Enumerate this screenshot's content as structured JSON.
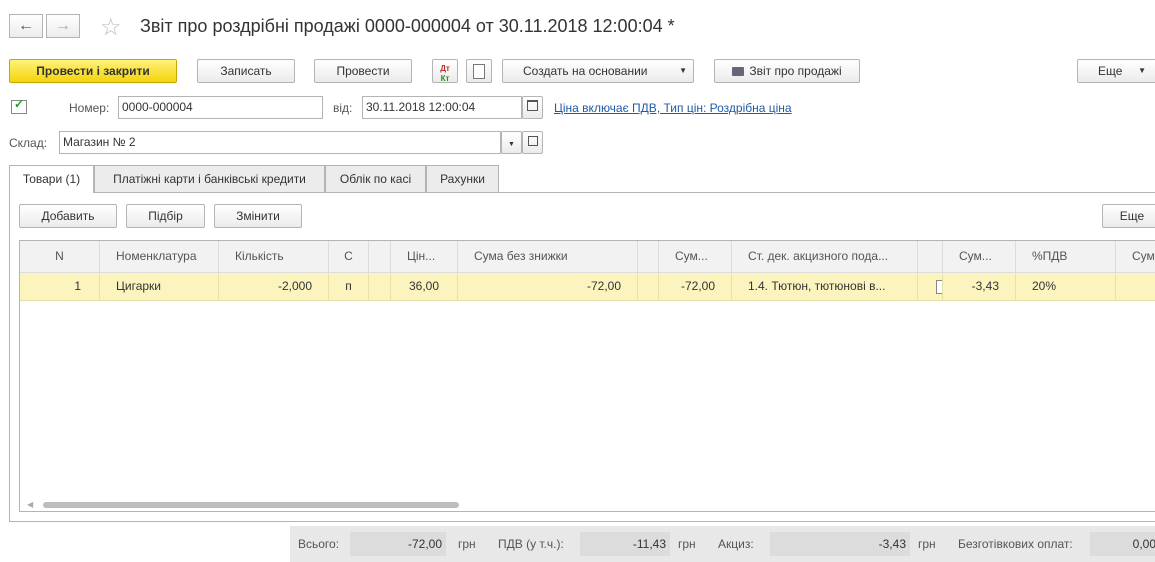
{
  "header": {
    "back_icon": "arrow-left-icon",
    "forward_icon": "arrow-right-icon",
    "favorite_icon": "star-icon",
    "title": "Звіт про роздрібні продажі 0000-000004 от 30.11.2018 12:00:04 *"
  },
  "toolbar": {
    "post_close": "Провести і закрити",
    "save": "Записать",
    "post": "Провести",
    "create_based": "Создать на основании",
    "report": "Звіт про продажі",
    "more": "Еще"
  },
  "form": {
    "number_label": "Номер:",
    "number_value": "0000-000004",
    "date_label": "від:",
    "date_value": "30.11.2018 12:00:04",
    "price_link": "Ціна включає ПДВ, Тип цін: Роздрібна ціна",
    "warehouse_label": "Склад:",
    "warehouse_value": "Магазин № 2"
  },
  "tabs": [
    {
      "label": "Товари (1)",
      "active": true
    },
    {
      "label": "Платіжні карти і банківські кредити",
      "active": false
    },
    {
      "label": "Облік по касі",
      "active": false
    },
    {
      "label": "Рахунки",
      "active": false
    }
  ],
  "table_toolbar": {
    "add": "Добавить",
    "select": "Підбір",
    "change": "Змінити",
    "more": "Еще"
  },
  "table": {
    "columns": [
      "N",
      "Номенклатура",
      "Кількість",
      "С",
      "",
      "Цін...",
      "Сума без знижки",
      "",
      "Сум...",
      "Ст. дек. акцизного пода...",
      "",
      "Сум...",
      "%ПДВ",
      "Сум"
    ],
    "rows": [
      [
        "1",
        "Цигарки",
        "-2,000",
        "п",
        "",
        "36,00",
        "-72,00",
        "",
        "-72,00",
        "1.4. Тютюн, тютюнові в...",
        "",
        "-3,43",
        "20%",
        ""
      ]
    ]
  },
  "footer": {
    "total_label": "Всього:",
    "total_value": "-72,00",
    "currency1": "грн",
    "vat_label": "ПДВ (у т.ч.):",
    "vat_value": "-11,43",
    "currency2": "грн",
    "excise_label": "Акциз:",
    "excise_value": "-3,43",
    "currency3": "грн",
    "cashless_label": "Безготівкових оплат:",
    "cashless_value": "0,00"
  },
  "colors": {
    "primary_button": "#f4d40c",
    "selected_row": "#fbf4be",
    "link": "#1d5ba8"
  }
}
